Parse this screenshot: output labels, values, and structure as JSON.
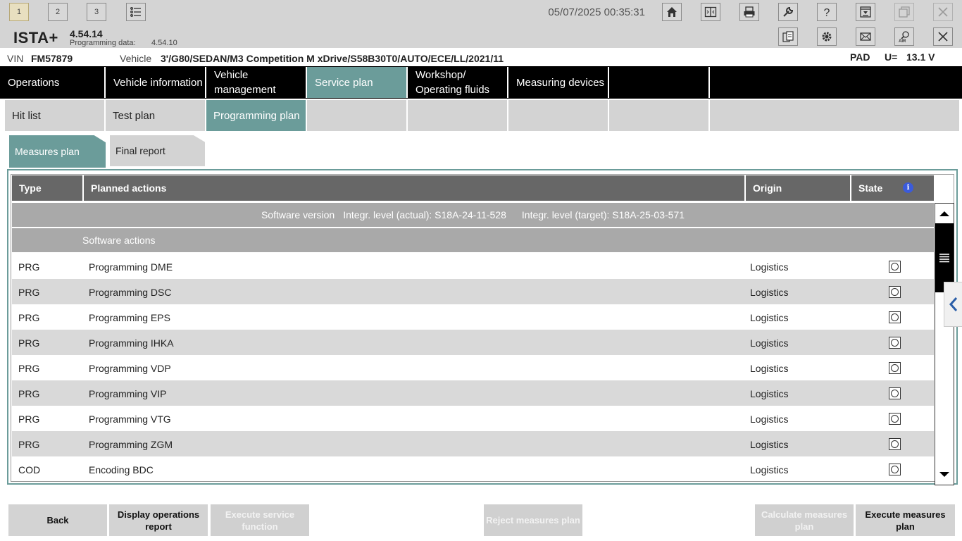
{
  "topbar": {
    "session_tabs": [
      "1",
      "2",
      "3"
    ],
    "datetime": "05/07/2025 00:35:31"
  },
  "app": {
    "name": "ISTA+",
    "version": "4.54.14",
    "programming_data_label": "Programming data:",
    "programming_data_value": "4.54.10"
  },
  "vehicle": {
    "vin_label": "VIN",
    "vin": "FM57879",
    "vehicle_label": "Vehicle",
    "vehicle_desc": "3'/G80/SEDAN/M3 Competition M xDrive/S58B30T0/AUTO/ECE/LL/2021/11",
    "pad": "PAD",
    "voltage_label": "U=",
    "voltage": "13.1 V"
  },
  "main_nav": [
    {
      "label": "Operations"
    },
    {
      "label": "Vehicle information"
    },
    {
      "label": "Vehicle management"
    },
    {
      "label": "Service plan"
    },
    {
      "label": "Workshop/ Operating fluids"
    },
    {
      "label": "Measuring devices"
    }
  ],
  "sub_nav": [
    {
      "label": "Hit list"
    },
    {
      "label": "Test plan"
    },
    {
      "label": "Programming plan"
    }
  ],
  "report_tabs": {
    "measures_plan": "Measures plan",
    "final_report": "Final report"
  },
  "table": {
    "headers": {
      "type": "Type",
      "planned_actions": "Planned actions",
      "origin": "Origin",
      "state": "State"
    },
    "software_version_label": "Software version",
    "integr_actual": "Integr. level (actual): S18A-24-11-528",
    "integr_target": "Integr. level (target): S18A-25-03-571",
    "software_actions_label": "Software actions",
    "rows": [
      {
        "type": "PRG",
        "action": "Programming DME",
        "origin": "Logistics"
      },
      {
        "type": "PRG",
        "action": "Programming DSC",
        "origin": "Logistics"
      },
      {
        "type": "PRG",
        "action": "Programming EPS",
        "origin": "Logistics"
      },
      {
        "type": "PRG",
        "action": "Programming IHKA",
        "origin": "Logistics"
      },
      {
        "type": "PRG",
        "action": "Programming VDP",
        "origin": "Logistics"
      },
      {
        "type": "PRG",
        "action": "Programming VIP",
        "origin": "Logistics"
      },
      {
        "type": "PRG",
        "action": "Programming VTG",
        "origin": "Logistics"
      },
      {
        "type": "PRG",
        "action": "Programming ZGM",
        "origin": "Logistics"
      },
      {
        "type": "COD",
        "action": "Encoding BDC",
        "origin": "Logistics"
      }
    ]
  },
  "buttons": {
    "back": "Back",
    "display_operations_report": "Display operations report",
    "execute_service_function": "Execute service function",
    "reject_measures_plan": "Reject measures plan",
    "calculate_measures_plan": "Calculate measures plan",
    "execute_measures_plan": "Execute measures plan"
  },
  "colors": {
    "accent_teal": "#6b9c9a",
    "header_dark": "#676767",
    "nav_black": "#000000"
  }
}
